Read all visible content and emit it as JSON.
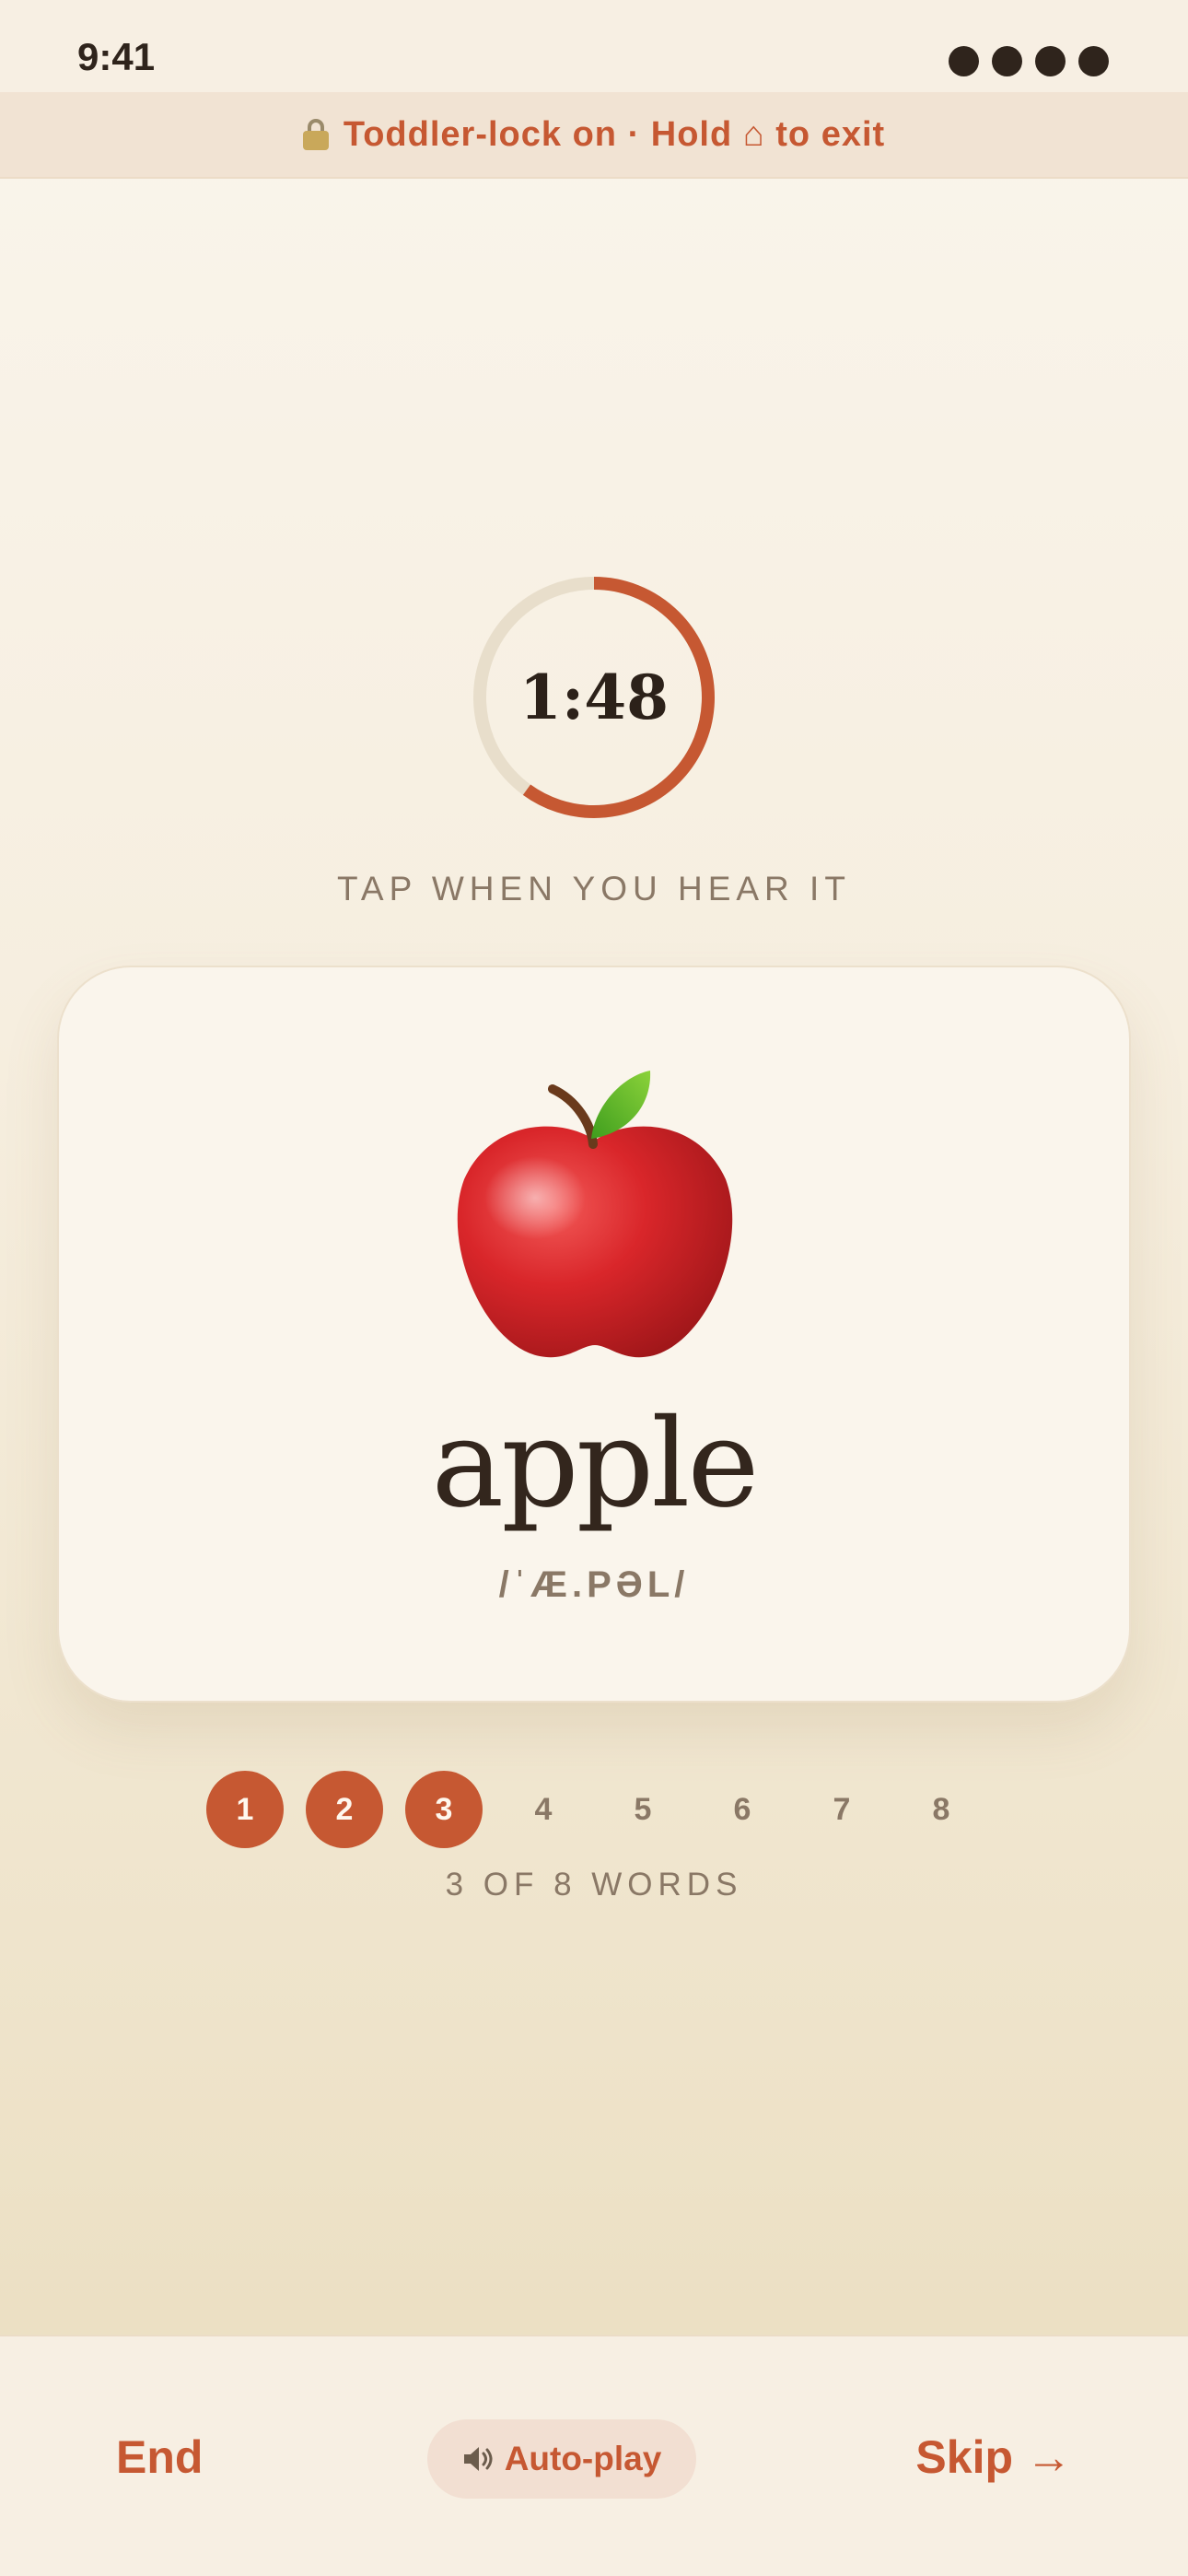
{
  "status": {
    "time": "9:41"
  },
  "banner": {
    "text": "Toddler-lock on · Hold ⌂ to exit",
    "icon": "lock-icon"
  },
  "timer": {
    "remaining": "1:48",
    "fraction_remaining": 0.6
  },
  "prompt": "TAP WHEN YOU HEAR IT",
  "card": {
    "image": "apple-emoji",
    "word": "apple",
    "phonetic": "/ˈÆ.PƏL/"
  },
  "progress": {
    "steps": [
      "1",
      "2",
      "3",
      "4",
      "5",
      "6",
      "7",
      "8"
    ],
    "completed": 3,
    "label": "3 OF 8 WORDS"
  },
  "footer": {
    "end_label": "End",
    "autoplay_label": "Auto-play",
    "autoplay_icon": "speaker-icon",
    "skip_label": "Skip",
    "skip_arrow": "→"
  },
  "colors": {
    "accent": "#c65832",
    "track": "#e8decb",
    "text_dark": "#33261d",
    "text_muted": "#8a7866"
  }
}
